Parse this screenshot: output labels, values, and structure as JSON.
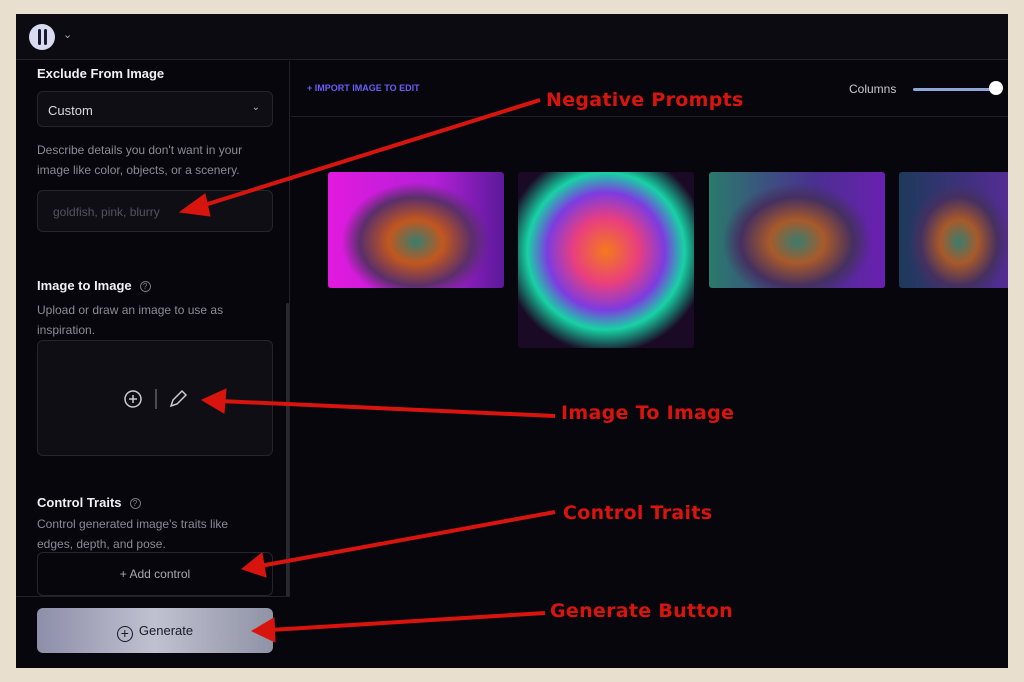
{
  "sidebar": {
    "exclude": {
      "title": "Exclude From Image",
      "preset": "Custom",
      "description": "Describe details you don't want in your image like color, objects, or a scenery.",
      "placeholder": "goldfish, pink, blurry"
    },
    "img2img": {
      "title": "Image to Image",
      "description": "Upload or draw an image to use as inspiration."
    },
    "control": {
      "title": "Control Traits",
      "description": "Control generated image's traits like edges, depth, and pose.",
      "add_label": "+ Add control"
    },
    "generate_label": "Generate"
  },
  "main": {
    "import_label": "+ IMPORT IMAGE TO EDIT",
    "columns_label": "Columns",
    "columns_value": 1.0
  },
  "annotations": {
    "negative": "Negative Prompts",
    "img2img": "Image To Image",
    "control": "Control Traits",
    "generate": "Generate Button",
    "color": "#d8140f"
  }
}
